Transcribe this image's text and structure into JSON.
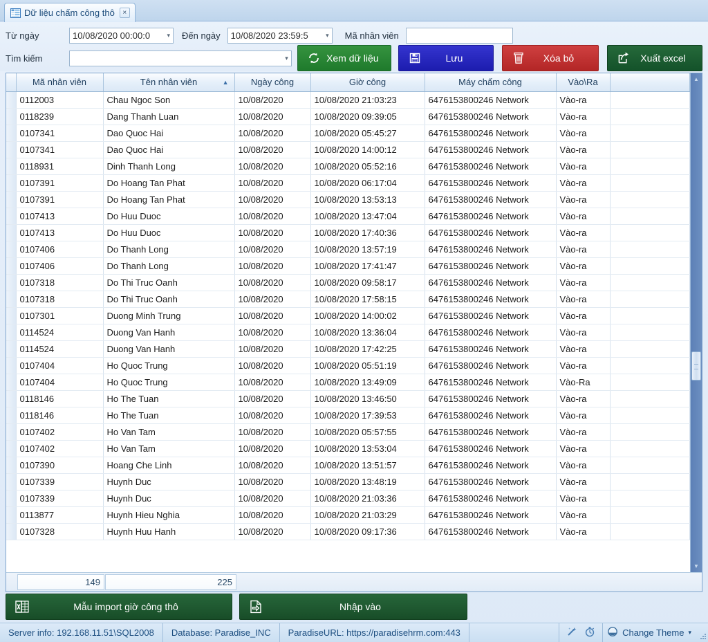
{
  "tab": {
    "title": "Dữ liệu chấm công thô",
    "close_label": "×",
    "icon": "grid-table-icon"
  },
  "filters": {
    "from_label": "Từ ngày",
    "from_value": "10/08/2020 00:00:0",
    "to_label": "Đến ngày",
    "to_value": "10/08/2020 23:59:5",
    "employee_code_label": "Mã nhân viên",
    "employee_code_value": "",
    "search_label": "Tìm kiếm",
    "search_value": "",
    "caret": "▾"
  },
  "toolbar": {
    "view_label": "Xem dữ liệu",
    "view_icon": "refresh-icon",
    "view_color": "#2a8a3a",
    "save_label": "Lưu",
    "save_icon": "floppy-save-icon",
    "save_color": "#2727c0",
    "delete_label": "Xóa bỏ",
    "delete_icon": "trash-icon",
    "delete_color": "#c03030",
    "excel_label": "Xuất excel",
    "excel_icon": "export-arrow-icon",
    "excel_color": "#1e5c2e"
  },
  "grid": {
    "sort_column": "Tên nhân viên",
    "sort_arrow": "▲",
    "columns": [
      "Mã nhân viên",
      "Tên nhân viên",
      "Ngày công",
      "Giờ công",
      "Máy chấm công",
      "Vào\\Ra"
    ],
    "rows": [
      [
        "0112003",
        "Chau Ngoc Son",
        "10/08/2020",
        "10/08/2020 21:03:23",
        "6476153800246 Network",
        "Vào-ra"
      ],
      [
        "0118239",
        "Dang Thanh Luan",
        "10/08/2020",
        "10/08/2020 09:39:05",
        "6476153800246 Network",
        "Vào-ra"
      ],
      [
        "0107341",
        "Dao Quoc Hai",
        "10/08/2020",
        "10/08/2020 05:45:27",
        "6476153800246 Network",
        "Vào-ra"
      ],
      [
        "0107341",
        "Dao Quoc Hai",
        "10/08/2020",
        "10/08/2020 14:00:12",
        "6476153800246 Network",
        "Vào-ra"
      ],
      [
        "0118931",
        "Dinh Thanh Long",
        "10/08/2020",
        "10/08/2020 05:52:16",
        "6476153800246 Network",
        "Vào-ra"
      ],
      [
        "0107391",
        "Do Hoang Tan Phat",
        "10/08/2020",
        "10/08/2020 06:17:04",
        "6476153800246 Network",
        "Vào-ra"
      ],
      [
        "0107391",
        "Do Hoang Tan Phat",
        "10/08/2020",
        "10/08/2020 13:53:13",
        "6476153800246 Network",
        "Vào-ra"
      ],
      [
        "0107413",
        "Do Huu Duoc",
        "10/08/2020",
        "10/08/2020 13:47:04",
        "6476153800246 Network",
        "Vào-ra"
      ],
      [
        "0107413",
        "Do Huu Duoc",
        "10/08/2020",
        "10/08/2020 17:40:36",
        "6476153800246 Network",
        "Vào-ra"
      ],
      [
        "0107406",
        "Do Thanh Long",
        "10/08/2020",
        "10/08/2020 13:57:19",
        "6476153800246 Network",
        "Vào-ra"
      ],
      [
        "0107406",
        "Do Thanh Long",
        "10/08/2020",
        "10/08/2020 17:41:47",
        "6476153800246 Network",
        "Vào-ra"
      ],
      [
        "0107318",
        "Do Thi Truc Oanh",
        "10/08/2020",
        "10/08/2020 09:58:17",
        "6476153800246 Network",
        "Vào-ra"
      ],
      [
        "0107318",
        "Do Thi Truc Oanh",
        "10/08/2020",
        "10/08/2020 17:58:15",
        "6476153800246 Network",
        "Vào-ra"
      ],
      [
        "0107301",
        "Duong Minh Trung",
        "10/08/2020",
        "10/08/2020 14:00:02",
        "6476153800246 Network",
        "Vào-ra"
      ],
      [
        "0114524",
        "Duong Van Hanh",
        "10/08/2020",
        "10/08/2020 13:36:04",
        "6476153800246 Network",
        "Vào-ra"
      ],
      [
        "0114524",
        "Duong Van Hanh",
        "10/08/2020",
        "10/08/2020 17:42:25",
        "6476153800246 Network",
        "Vào-ra"
      ],
      [
        "0107404",
        "Ho Quoc Trung",
        "10/08/2020",
        "10/08/2020 05:51:19",
        "6476153800246 Network",
        "Vào-ra"
      ],
      [
        "0107404",
        "Ho Quoc Trung",
        "10/08/2020",
        "10/08/2020 13:49:09",
        "6476153800246 Network",
        "Vào-Ra"
      ],
      [
        "0118146",
        "Ho The Tuan",
        "10/08/2020",
        "10/08/2020 13:46:50",
        "6476153800246 Network",
        "Vào-ra"
      ],
      [
        "0118146",
        "Ho The Tuan",
        "10/08/2020",
        "10/08/2020 17:39:53",
        "6476153800246 Network",
        "Vào-ra"
      ],
      [
        "0107402",
        "Ho Van Tam",
        "10/08/2020",
        "10/08/2020 05:57:55",
        "6476153800246 Network",
        "Vào-ra"
      ],
      [
        "0107402",
        "Ho Van Tam",
        "10/08/2020",
        "10/08/2020 13:53:04",
        "6476153800246 Network",
        "Vào-ra"
      ],
      [
        "0107390",
        "Hoang Che Linh",
        "10/08/2020",
        "10/08/2020 13:51:57",
        "6476153800246 Network",
        "Vào-ra"
      ],
      [
        "0107339",
        "Huynh Duc",
        "10/08/2020",
        "10/08/2020 13:48:19",
        "6476153800246 Network",
        "Vào-ra"
      ],
      [
        "0107339",
        "Huynh Duc",
        "10/08/2020",
        "10/08/2020 21:03:36",
        "6476153800246 Network",
        "Vào-ra"
      ],
      [
        "0113877",
        "Huynh Hieu Nghia",
        "10/08/2020",
        "10/08/2020 21:03:29",
        "6476153800246 Network",
        "Vào-ra"
      ],
      [
        "0107328",
        "Huynh Huu Hanh",
        "10/08/2020",
        "10/08/2020 09:17:36",
        "6476153800246 Network",
        "Vào-ra"
      ]
    ],
    "summary": {
      "code_count": "149",
      "name_count": "225"
    }
  },
  "bottom": {
    "template_label": "Mẫu import giờ công thô",
    "template_icon": "excel-file-icon",
    "import_label": "Nhập vào",
    "import_icon": "import-file-icon"
  },
  "statusbar": {
    "server_info": "Server info:  192.168.11.51\\SQL2008",
    "database": "Database:  Paradise_INC",
    "url": "ParadiseURL:  https://paradisehrm.com:443",
    "wand_icon": "magic-wand-icon",
    "stopwatch_icon": "stopwatch-icon",
    "theme_icon": "theme-circle-icon",
    "theme_label": "Change Theme",
    "theme_caret": "▾"
  }
}
